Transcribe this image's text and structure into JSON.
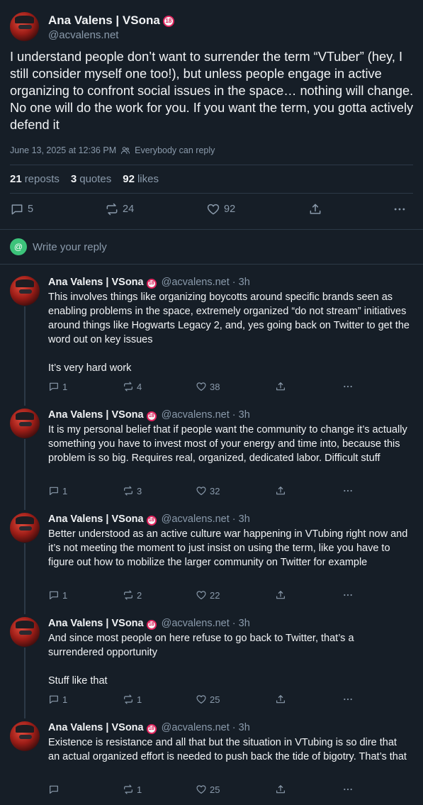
{
  "post": {
    "author_name": "Ana Valens | VSona",
    "age_badge": "18",
    "handle": "@acvalens.net",
    "text": "I understand people don’t want to surrender the term “VTuber” (hey, I still consider myself one too!), but unless people engage in active organizing to confront social issues in the space… nothing will change. No one will do the work for you. If you want the term, you gotta actively defend it",
    "timestamp": "June 13, 2025 at 12:36 PM",
    "reply_setting": "Everybody can reply",
    "reposts_count": "21",
    "reposts_label": "reposts",
    "quotes_count": "3",
    "quotes_label": "quotes",
    "likes_count": "92",
    "likes_label": "likes",
    "actions": {
      "replies": "5",
      "reposts": "24",
      "likes": "92"
    }
  },
  "reply_box": {
    "icon": "@",
    "placeholder": "Write your reply"
  },
  "replies": [
    {
      "author_name": "Ana Valens | VSona",
      "age_badge": "18",
      "handle_time": "@acvalens.net · 3h",
      "text": "This involves things like organizing boycotts around specific brands seen as enabling problems in the space, extremely organized “do not stream” initiatives around things like Hogwarts Legacy 2, and, yes going back on Twitter to get the word out on key issues\n\nIt’s very hard work",
      "replies": "1",
      "reposts": "4",
      "likes": "38"
    },
    {
      "author_name": "Ana Valens | VSona",
      "age_badge": "18",
      "handle_time": "@acvalens.net · 3h",
      "text": "It is my personal belief that if people want the community to change it’s actually something you have to invest most of your energy and time into, because this problem is so big. Requires real, organized, dedicated labor. Difficult stuff",
      "replies": "1",
      "reposts": "3",
      "likes": "32"
    },
    {
      "author_name": "Ana Valens | VSona",
      "age_badge": "18",
      "handle_time": "@acvalens.net · 3h",
      "text": "Better understood as an active culture war happening in VTubing right now and it’s not meeting the moment to just insist on using the term, like you have to figure out how to mobilize the larger community on Twitter for example",
      "replies": "1",
      "reposts": "2",
      "likes": "22"
    },
    {
      "author_name": "Ana Valens | VSona",
      "age_badge": "18",
      "handle_time": "@acvalens.net · 3h",
      "text": "And since most people on here refuse to go back to Twitter, that’s a surrendered opportunity\n\nStuff like that",
      "replies": "1",
      "reposts": "1",
      "likes": "25"
    },
    {
      "author_name": "Ana Valens | VSona",
      "age_badge": "18",
      "handle_time": "@acvalens.net · 3h",
      "text": "Existence is resistance and all that but the situation in VTubing is so dire that an actual organized effort is needed to push back the tide of bigotry. That’s that",
      "replies": "",
      "reposts": "1",
      "likes": "25"
    }
  ],
  "colors": {
    "background": "#161e27",
    "text": "#f1f3f5",
    "muted": "#8a9aab",
    "divider": "#2c3947",
    "accent_reply": "#3cc37a"
  }
}
